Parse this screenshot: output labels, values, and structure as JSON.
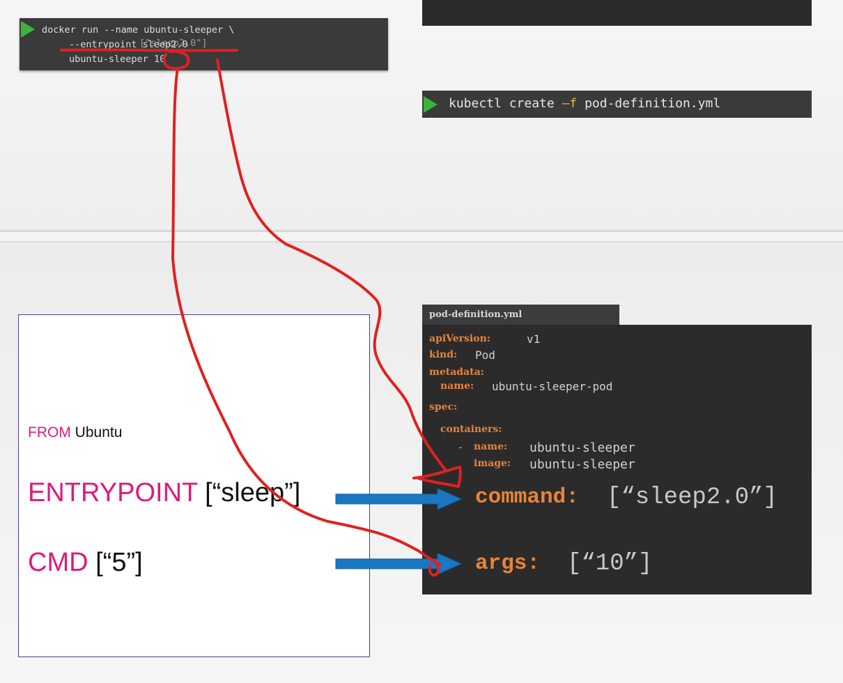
{
  "docker_cmd": {
    "line1": "docker run --name ubuntu-sleeper \\",
    "line2": "--entrypoint sleep2.0",
    "line2_ghost": "[\"sleep2.0\"]",
    "line3_prefix": "ubuntu-sleeper",
    "line3_arg": "10"
  },
  "kubectl_cmd": {
    "command": "kubectl create ",
    "flag": "–f",
    "file": " pod-definition.yml"
  },
  "dockerfile": {
    "from_kw": "FROM",
    "from_val": "Ubuntu",
    "entrypoint_kw": "ENTRYPOINT",
    "entrypoint_val": "[“sleep”]",
    "cmd_kw": "CMD",
    "cmd_val": "[“5”]"
  },
  "pod_yaml": {
    "filename": "pod-definition.yml",
    "api_version_key": "apiVersion:",
    "api_version_val": "v1",
    "kind_key": "kind:",
    "kind_val": "Pod",
    "metadata_key": "metadata:",
    "name_key": "name:",
    "name_val": "ubuntu-sleeper-pod",
    "spec_key": "spec:",
    "containers_key": "containers:",
    "dash": "-",
    "container_name_key": "name:",
    "container_name_val": "ubuntu-sleeper",
    "image_key": "image:",
    "image_val": "ubuntu-sleeper",
    "command_key": "command:",
    "command_val": "[“sleep2.0”]",
    "args_key": "args:",
    "args_val": "[“10”]"
  },
  "colors": {
    "keyword": "#e0197d",
    "yaml_key": "#e8843a",
    "terminal_bg": "#2b2b2b",
    "play": "#3cb43c",
    "arrow_blue": "#1a78c2",
    "annotation_red": "#e02020"
  }
}
